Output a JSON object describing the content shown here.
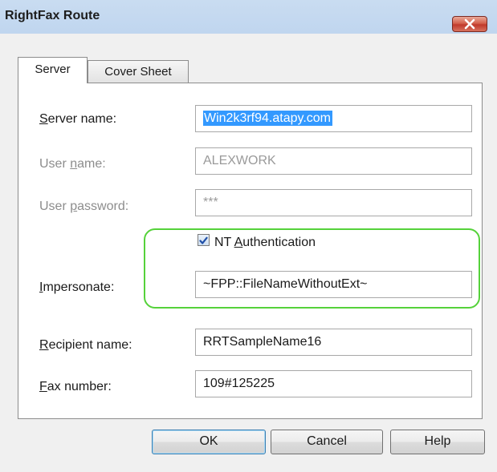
{
  "window": {
    "title": "RightFax Route"
  },
  "tabs": [
    {
      "label": "Server",
      "active": true
    },
    {
      "label": "Cover Sheet",
      "active": false
    }
  ],
  "server": {
    "server_name": {
      "label_pre": "",
      "label_acc": "S",
      "label_post": "erver name:",
      "value": "Win2k3rf94.atapy.com"
    },
    "user_name": {
      "label_pre": "User ",
      "label_acc": "n",
      "label_post": "ame:",
      "value": "ALEXWORK"
    },
    "user_password": {
      "label_pre": "User ",
      "label_acc": "p",
      "label_post": "assword:",
      "value": "***"
    },
    "nt_auth": {
      "label_pre": "NT ",
      "label_acc": "A",
      "label_post": "uthentication",
      "checked": true
    },
    "impersonate": {
      "label_pre": "",
      "label_acc": "I",
      "label_post": "mpersonate:",
      "value": "~FPP::FileNameWithoutExt~"
    },
    "recipient_name": {
      "label_pre": "",
      "label_acc": "R",
      "label_post": "ecipient name:",
      "value": "RRTSampleName16"
    },
    "fax_number": {
      "label_pre": "",
      "label_acc": "F",
      "label_post": "ax number:",
      "value": "109#125225"
    }
  },
  "buttons": {
    "ok": "OK",
    "cancel": "Cancel",
    "help": "Help"
  },
  "colors": {
    "highlight_outline": "#55d23a",
    "selection": "#3399ff",
    "close_button": "#c0392b"
  }
}
